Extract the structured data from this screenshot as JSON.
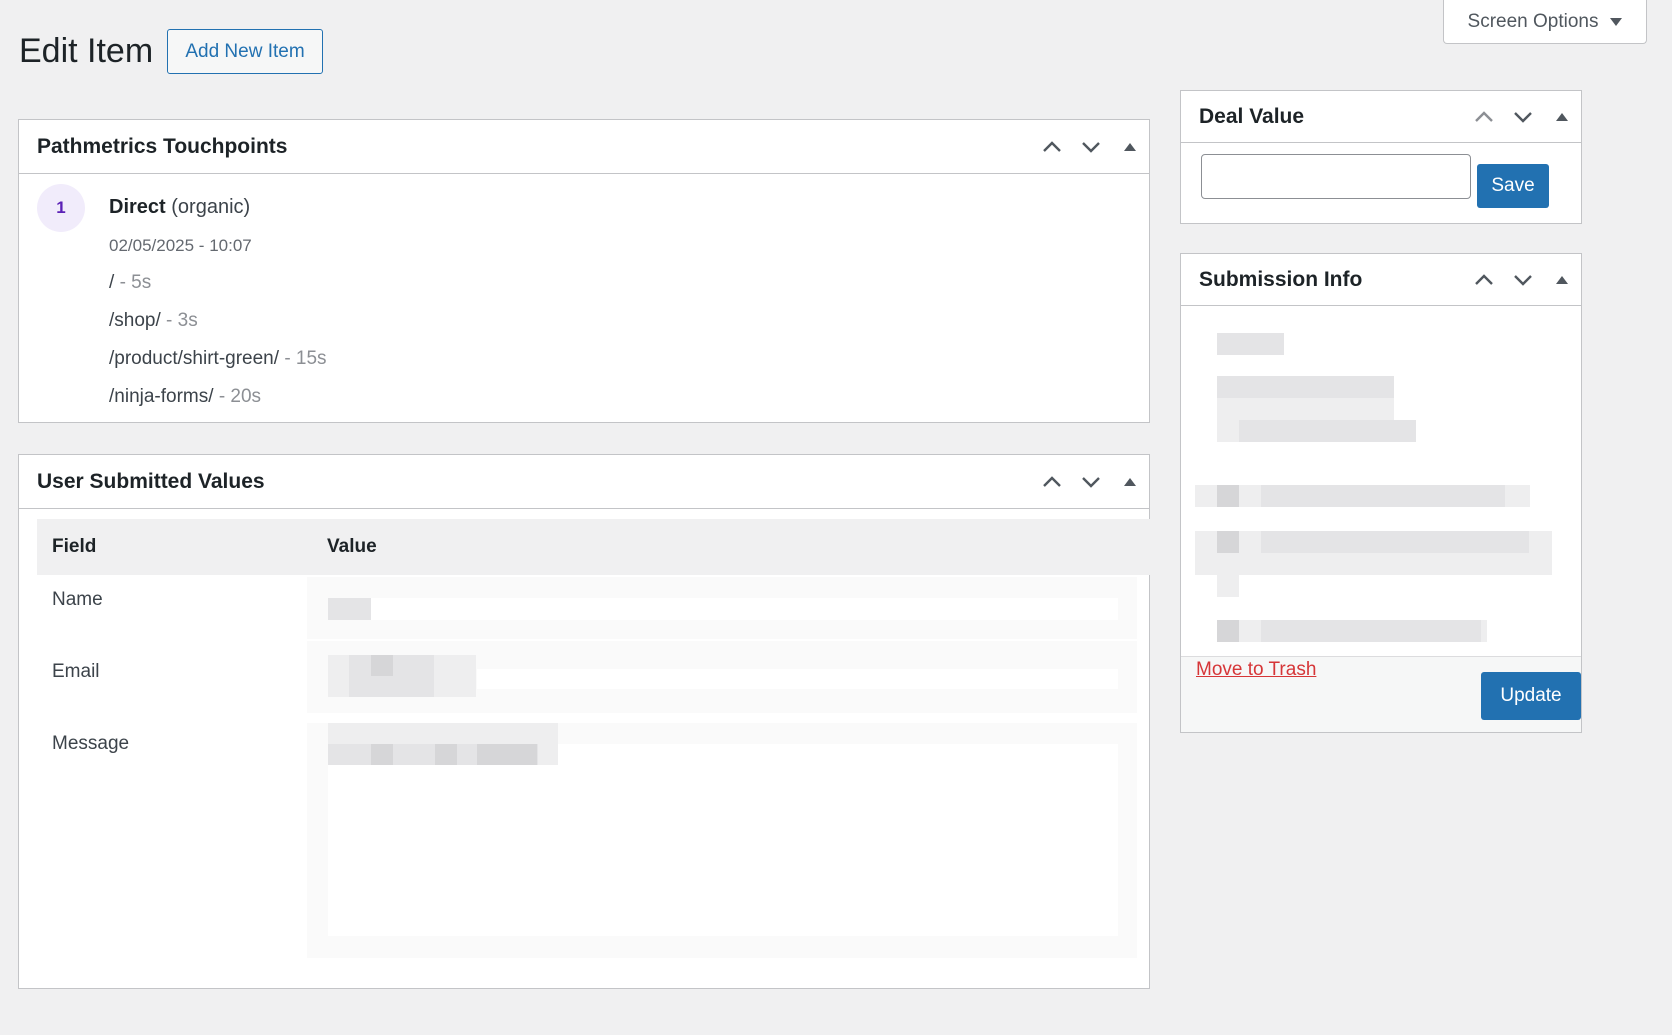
{
  "header": {
    "page_title": "Edit Item",
    "add_new_label": "Add New Item",
    "screen_options_label": "Screen Options"
  },
  "touchpoints": {
    "title": "Pathmetrics Touchpoints",
    "badge_number": "1",
    "source_name": "Direct",
    "source_type": "(organic)",
    "datetime": "02/05/2025 - 10:07",
    "paths": [
      {
        "path": "/",
        "duration": "- 5s"
      },
      {
        "path": "/shop/",
        "duration": "- 3s"
      },
      {
        "path": "/product/shirt-green/",
        "duration": "- 15s"
      },
      {
        "path": "/ninja-forms/",
        "duration": "- 20s"
      }
    ]
  },
  "submitted_values": {
    "title": "User Submitted Values",
    "columns": [
      "Field",
      "Value"
    ],
    "rows": [
      {
        "field": "Name"
      },
      {
        "field": "Email"
      },
      {
        "field": "Message"
      }
    ]
  },
  "deal_value": {
    "title": "Deal Value",
    "input_value": "",
    "save_label": "Save"
  },
  "submission_info": {
    "title": "Submission Info",
    "trash_label": "Move to Trash",
    "update_label": "Update"
  },
  "colors": {
    "primary": "#2271b1",
    "danger": "#d63638",
    "background": "#f0f0f1",
    "badge_bg": "#f1ecfb",
    "badge_text": "#5b21b6"
  },
  "icons": [
    "chevron-up-icon",
    "chevron-down-icon",
    "toggle-triangle-icon",
    "caret-down-icon"
  ]
}
